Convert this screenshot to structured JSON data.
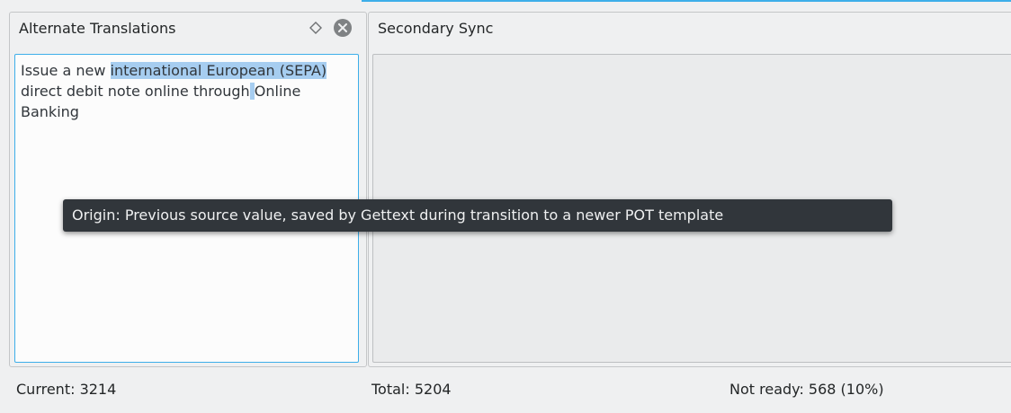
{
  "docks": {
    "left": {
      "title": "Alternate Translations",
      "text": {
        "before": "Issue a new ",
        "selected": "international European (SEPA)",
        "middle": " direct debit note online through",
        "selected2": " ",
        "after": "Online Banking"
      },
      "icons": [
        "float-diamond-icon",
        "close-circle-icon"
      ]
    },
    "right": {
      "title": "Secondary Sync"
    }
  },
  "tooltip": {
    "text": "Origin: Previous source value, saved by Gettext during transition to a newer POT template"
  },
  "status": {
    "current": "Current: 3214",
    "total": "Total: 5204",
    "not_ready": "Not ready: 568 (10%)"
  },
  "colors": {
    "accent": "#3daee9",
    "selection": "#a6cdf0",
    "tooltip_bg": "#31363b"
  }
}
